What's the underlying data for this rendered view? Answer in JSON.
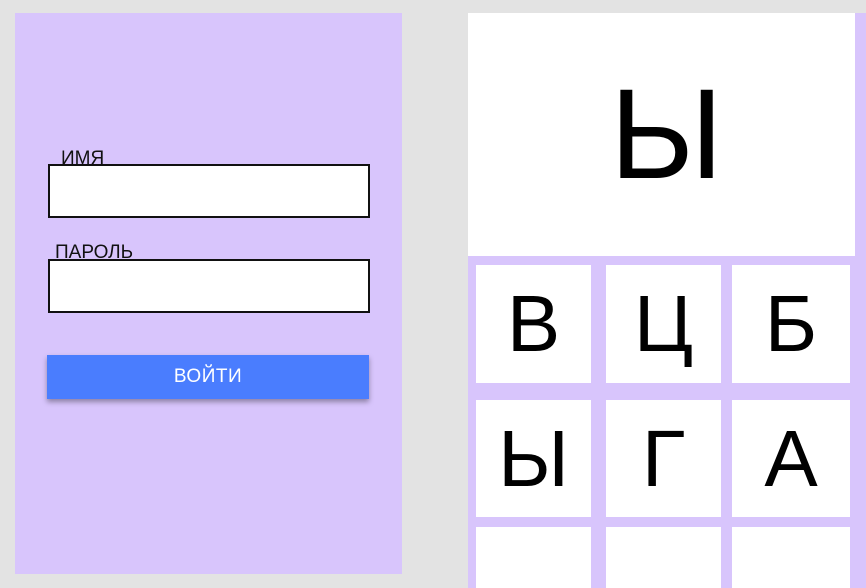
{
  "login": {
    "name_label": "ИМЯ",
    "name_value": "",
    "password_label": "ПАРОЛЬ",
    "password_value": "",
    "submit_label": "ВОЙТИ"
  },
  "game": {
    "target_letter": "Ы",
    "tiles": [
      {
        "letter": "В"
      },
      {
        "letter": "Ц"
      },
      {
        "letter": "Б"
      },
      {
        "letter": "Ы"
      },
      {
        "letter": "Г"
      },
      {
        "letter": "А"
      },
      {
        "letter": ""
      },
      {
        "letter": ""
      },
      {
        "letter": ""
      }
    ]
  },
  "colors": {
    "page_background": "#e3e3e3",
    "panel_background": "#d8c5fc",
    "button_accent": "#4a7dfe",
    "tile_background": "#ffffff"
  }
}
